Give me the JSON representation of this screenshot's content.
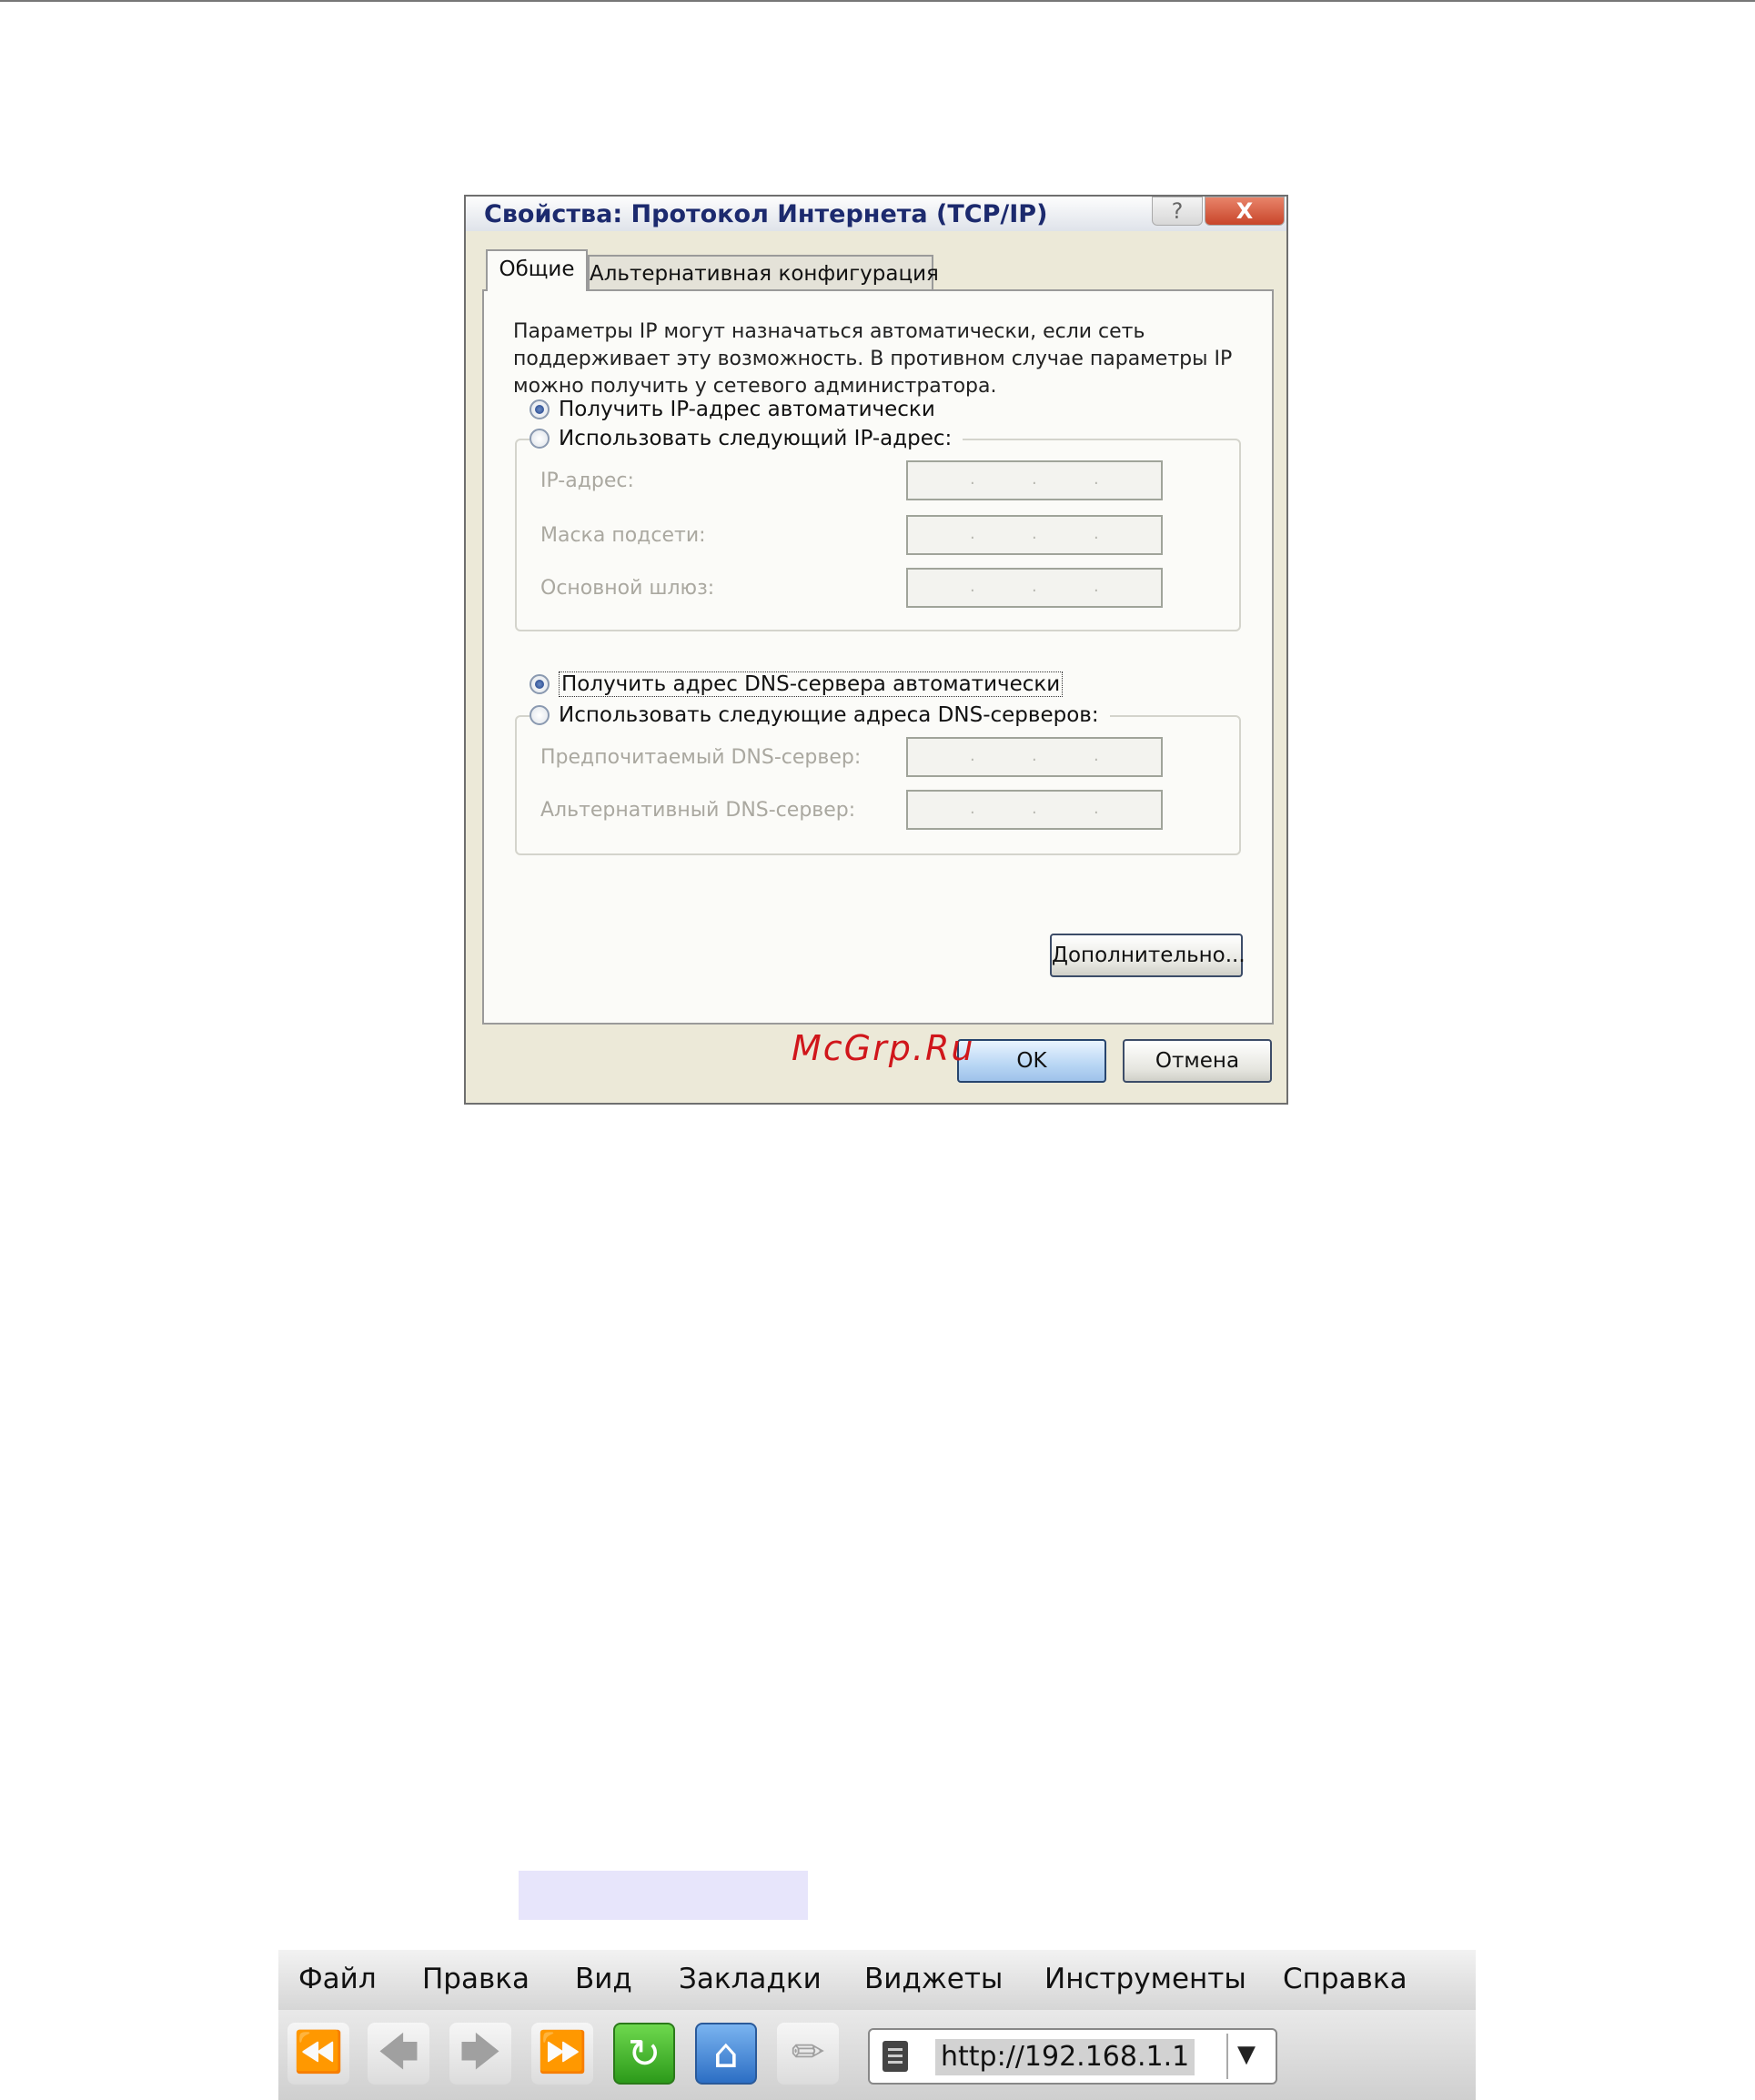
{
  "dialog": {
    "title": "Свойства: Протокол Интернета (TCP/IP)",
    "help_label": "?",
    "close_label": "X",
    "tabs": [
      {
        "label": "Общие"
      },
      {
        "label": "Альтернативная конфигурация"
      }
    ],
    "description": "Параметры IP могут назначаться автоматически, если сеть поддерживает эту возможность. В противном случае параметры IP можно получить у сетевого администратора.",
    "ip_auto_label": "Получить IP-адрес автоматически",
    "ip_manual_label": "Использовать следующий IP-адрес:",
    "ip_fields": {
      "ip": "IP-адрес:",
      "mask": "Маска подсети:",
      "gateway": "Основной шлюз:"
    },
    "dns_auto_label": "Получить адрес DNS-сервера автоматически",
    "dns_manual_label": "Использовать следующие адреса DNS-серверов:",
    "dns_fields": {
      "preferred": "Предпочитаемый DNS-сервер:",
      "alternate": "Альтернативный DNS-сервер:"
    },
    "ip_dot": ".",
    "advanced_button": "Дополнительно...",
    "ok_button": "OK",
    "cancel_button": "Отмена"
  },
  "watermark": "McGrp.Ru",
  "browser": {
    "menu": [
      "Файл",
      "Правка",
      "Вид",
      "Закладки",
      "Виджеты",
      "Инструменты",
      "Справка"
    ],
    "url": "http://192.168.1.1",
    "icons": [
      "rewind-icon",
      "back-icon",
      "forward-icon",
      "fast-forward-icon",
      "reload-icon",
      "home-icon",
      "edit-icon",
      "page-icon",
      "dropdown-icon"
    ],
    "colors": {
      "reload": "#2c9a1a",
      "home": "#2c6ec4"
    }
  }
}
